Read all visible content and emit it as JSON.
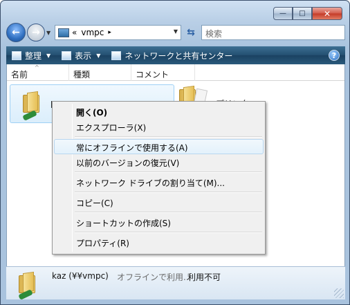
{
  "window": {
    "caption_buttons": {
      "minimize": "—",
      "maximize": "□",
      "close": "✕"
    }
  },
  "nav": {
    "breadcrumb_prefix": "«",
    "location": "vmpc",
    "location_chevron": "▸",
    "search_placeholder": "検索"
  },
  "toolbar": {
    "organize": "整理",
    "views": "表示",
    "network_sharing": "ネットワークと共有センター",
    "help": "?"
  },
  "columns": [
    "名前",
    "種類",
    "コメント"
  ],
  "items": [
    {
      "name": "ka"
    },
    {
      "name": "プリンタ"
    }
  ],
  "context_menu": {
    "groups": [
      [
        "開く(O)",
        "エクスプローラ(X)"
      ],
      [
        "常にオフラインで使用する(A)",
        "以前のバージョンの復元(V)"
      ],
      [
        "ネットワーク ドライブの割り当て(M)..."
      ],
      [
        "コピー(C)"
      ],
      [
        "ショートカットの作成(S)"
      ],
      [
        "プロパティ(R)"
      ]
    ],
    "default_item": "開く(O)",
    "highlighted_item": "常にオフラインで使用する(A)"
  },
  "details": {
    "name": "kaz (¥¥vmpc)",
    "status": "オフラインで利用...",
    "availability": "利用不可"
  }
}
